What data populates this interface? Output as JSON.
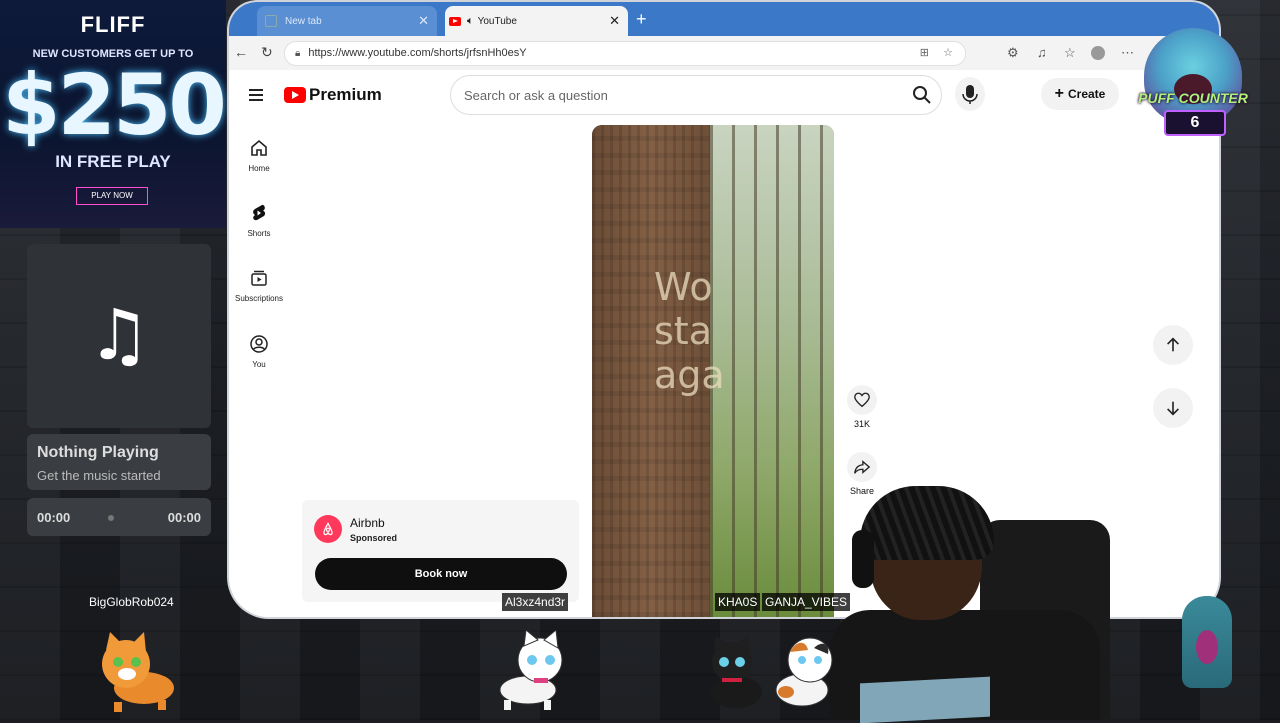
{
  "ad": {
    "brand": "FLIFF",
    "promo": "NEW CUSTOMERS GET UP TO",
    "amount": "$250",
    "freeplay": "IN FREE PLAY",
    "cta": "PLAY NOW"
  },
  "music": {
    "title": "Nothing Playing",
    "subtitle": "Get the music started",
    "time_current": "00:00",
    "time_total": "00:00"
  },
  "browser": {
    "tabs": [
      {
        "label": "New tab",
        "active": false
      },
      {
        "label": "YouTube",
        "active": true
      }
    ],
    "url": "https://www.youtube.com/shorts/jrfsnHh0esY"
  },
  "youtube": {
    "logo_text": "Premium",
    "search_placeholder": "Search or ask a question",
    "create_label": "Create",
    "sidebar": [
      {
        "label": "Home",
        "icon": "home-icon"
      },
      {
        "label": "Shorts",
        "icon": "shorts-icon"
      },
      {
        "label": "Subscriptions",
        "icon": "subscriptions-icon"
      },
      {
        "label": "You",
        "icon": "account-icon"
      }
    ],
    "actions": {
      "like_count": "31K",
      "share_label": "Share"
    },
    "ad_card": {
      "advertiser": "Airbnb",
      "sponsored": "Sponsored",
      "cta": "Book now"
    },
    "short_overlay_text": [
      "Wo",
      "sta",
      "aga"
    ]
  },
  "overlay": {
    "puff_counter_label": "PUFF COUNTER",
    "puff_count": "6",
    "usernames": {
      "left": "BigGlobRob024",
      "middle": "Al3xz4nd3r",
      "right_1": "KHA0S",
      "right_2": "GANJA_VIBES"
    }
  }
}
